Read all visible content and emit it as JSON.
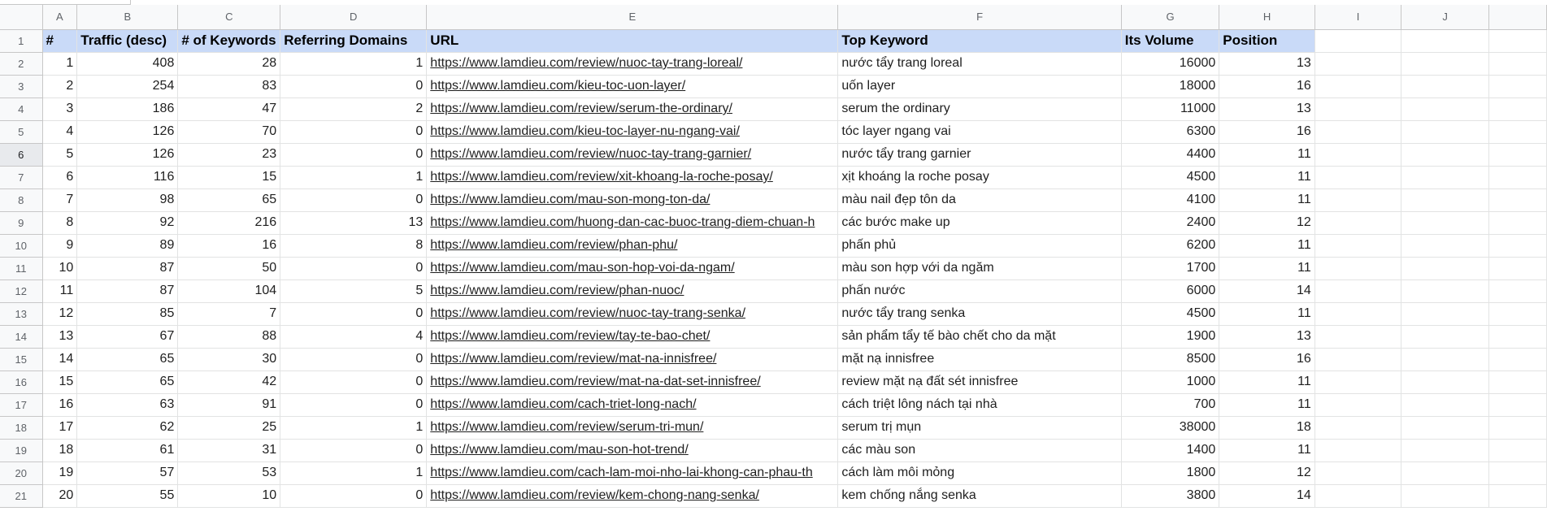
{
  "column_headers": [
    "A",
    "B",
    "C",
    "D",
    "E",
    "F",
    "G",
    "H",
    "I",
    "J"
  ],
  "header_row": {
    "row_number": "1",
    "cells": [
      "#",
      "Traffic (desc)",
      "# of Keywords",
      "Referring Domains",
      "URL",
      "Top Keyword",
      "Its Volume",
      "Position"
    ]
  },
  "rows": [
    {
      "n": "2",
      "idx": "1",
      "traffic": "408",
      "keywords": "28",
      "domains": "1",
      "url": "https://www.lamdieu.com/review/nuoc-tay-trang-loreal/",
      "keyword": "nước tẩy trang loreal",
      "volume": "16000",
      "position": "13"
    },
    {
      "n": "3",
      "idx": "2",
      "traffic": "254",
      "keywords": "83",
      "domains": "0",
      "url": "https://www.lamdieu.com/kieu-toc-uon-layer/",
      "keyword": "uốn layer",
      "volume": "18000",
      "position": "16"
    },
    {
      "n": "4",
      "idx": "3",
      "traffic": "186",
      "keywords": "47",
      "domains": "2",
      "url": "https://www.lamdieu.com/review/serum-the-ordinary/",
      "keyword": "serum the ordinary",
      "volume": "11000",
      "position": "13"
    },
    {
      "n": "5",
      "idx": "4",
      "traffic": "126",
      "keywords": "70",
      "domains": "0",
      "url": "https://www.lamdieu.com/kieu-toc-layer-nu-ngang-vai/",
      "keyword": "tóc layer ngang vai",
      "volume": "6300",
      "position": "16"
    },
    {
      "n": "6",
      "idx": "5",
      "traffic": "126",
      "keywords": "23",
      "domains": "0",
      "url": "https://www.lamdieu.com/review/nuoc-tay-trang-garnier/",
      "keyword": "nước tẩy trang garnier",
      "volume": "4400",
      "position": "11"
    },
    {
      "n": "7",
      "idx": "6",
      "traffic": "116",
      "keywords": "15",
      "domains": "1",
      "url": "https://www.lamdieu.com/review/xit-khoang-la-roche-posay/",
      "keyword": "xịt khoáng la roche posay",
      "volume": "4500",
      "position": "11"
    },
    {
      "n": "8",
      "idx": "7",
      "traffic": "98",
      "keywords": "65",
      "domains": "0",
      "url": "https://www.lamdieu.com/mau-son-mong-ton-da/",
      "keyword": "màu nail đẹp tôn da",
      "volume": "4100",
      "position": "11"
    },
    {
      "n": "9",
      "idx": "8",
      "traffic": "92",
      "keywords": "216",
      "domains": "13",
      "url": "https://www.lamdieu.com/huong-dan-cac-buoc-trang-diem-chuan-h",
      "keyword": "các bước make up",
      "volume": "2400",
      "position": "12"
    },
    {
      "n": "10",
      "idx": "9",
      "traffic": "89",
      "keywords": "16",
      "domains": "8",
      "url": "https://www.lamdieu.com/review/phan-phu/",
      "keyword": "phấn phủ",
      "volume": "6200",
      "position": "11"
    },
    {
      "n": "11",
      "idx": "10",
      "traffic": "87",
      "keywords": "50",
      "domains": "0",
      "url": "https://www.lamdieu.com/mau-son-hop-voi-da-ngam/",
      "keyword": "màu son hợp với da ngăm",
      "volume": "1700",
      "position": "11"
    },
    {
      "n": "12",
      "idx": "11",
      "traffic": "87",
      "keywords": "104",
      "domains": "5",
      "url": "https://www.lamdieu.com/review/phan-nuoc/",
      "keyword": "phấn nước",
      "volume": "6000",
      "position": "14"
    },
    {
      "n": "13",
      "idx": "12",
      "traffic": "85",
      "keywords": "7",
      "domains": "0",
      "url": "https://www.lamdieu.com/review/nuoc-tay-trang-senka/",
      "keyword": "nước tẩy trang senka",
      "volume": "4500",
      "position": "11"
    },
    {
      "n": "14",
      "idx": "13",
      "traffic": "67",
      "keywords": "88",
      "domains": "4",
      "url": "https://www.lamdieu.com/review/tay-te-bao-chet/",
      "keyword": "sản phẩm tẩy tế bào chết cho da mặt",
      "volume": "1900",
      "position": "13"
    },
    {
      "n": "15",
      "idx": "14",
      "traffic": "65",
      "keywords": "30",
      "domains": "0",
      "url": "https://www.lamdieu.com/review/mat-na-innisfree/",
      "keyword": "mặt nạ innisfree",
      "volume": "8500",
      "position": "16"
    },
    {
      "n": "16",
      "idx": "15",
      "traffic": "65",
      "keywords": "42",
      "domains": "0",
      "url": "https://www.lamdieu.com/review/mat-na-dat-set-innisfree/",
      "keyword": "review mặt nạ đất sét innisfree",
      "volume": "1000",
      "position": "11"
    },
    {
      "n": "17",
      "idx": "16",
      "traffic": "63",
      "keywords": "91",
      "domains": "0",
      "url": "https://www.lamdieu.com/cach-triet-long-nach/",
      "keyword": "cách triệt lông nách tại nhà",
      "volume": "700",
      "position": "11"
    },
    {
      "n": "18",
      "idx": "17",
      "traffic": "62",
      "keywords": "25",
      "domains": "1",
      "url": "https://www.lamdieu.com/review/serum-tri-mun/",
      "keyword": "serum trị mụn",
      "volume": "38000",
      "position": "18"
    },
    {
      "n": "19",
      "idx": "18",
      "traffic": "61",
      "keywords": "31",
      "domains": "0",
      "url": "https://www.lamdieu.com/mau-son-hot-trend/",
      "keyword": "các màu son",
      "volume": "1400",
      "position": "11"
    },
    {
      "n": "20",
      "idx": "19",
      "traffic": "57",
      "keywords": "53",
      "domains": "1",
      "url": "https://www.lamdieu.com/cach-lam-moi-nho-lai-khong-can-phau-th",
      "keyword": "cách làm môi mỏng",
      "volume": "1800",
      "position": "12"
    },
    {
      "n": "21",
      "idx": "20",
      "traffic": "55",
      "keywords": "10",
      "domains": "0",
      "url": "https://www.lamdieu.com/review/kem-chong-nang-senka/",
      "keyword": "kem chống nắng senka",
      "volume": "3800",
      "position": "14"
    }
  ],
  "colors": {
    "header_fill": "#c9daf8",
    "grid_line": "#e2e3e3",
    "header_bg": "#f8f9fa"
  }
}
